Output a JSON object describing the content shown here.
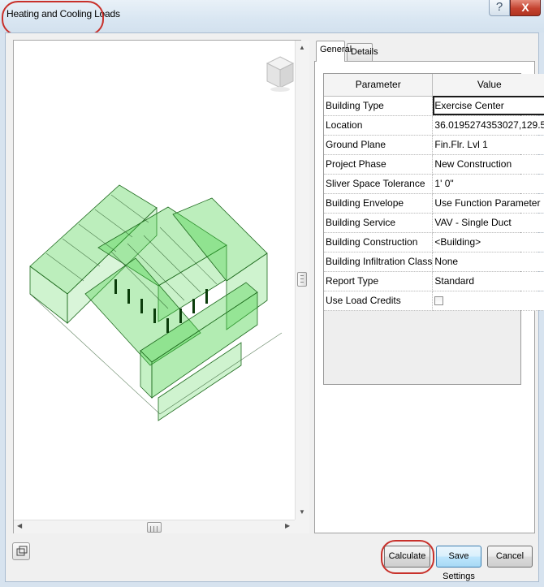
{
  "window": {
    "title": "Heating and Cooling Loads",
    "help_glyph": "?",
    "close_glyph": "X",
    "accent_annotation_color": "#c8302a"
  },
  "viewer": {
    "model_color": "#3fcf3f",
    "viewcube_icon": "viewcube-icon"
  },
  "tabs": [
    {
      "label": "General",
      "active": true
    },
    {
      "label": "Details",
      "active": false
    }
  ],
  "grid": {
    "headers": {
      "parameter": "Parameter",
      "value": "Value"
    },
    "rows": [
      {
        "parameter": "Building Type",
        "value": "Exercise Center"
      },
      {
        "parameter": "Location",
        "value": "36.0195274353027,129.5"
      },
      {
        "parameter": "Ground Plane",
        "value": "Fin.Flr. Lvl 1"
      },
      {
        "parameter": "Project Phase",
        "value": "New Construction"
      },
      {
        "parameter": "Sliver Space Tolerance",
        "value": "1'  0\""
      },
      {
        "parameter": "Building Envelope",
        "value": "Use Function Parameter"
      },
      {
        "parameter": "Building Service",
        "value": "VAV - Single Duct"
      },
      {
        "parameter": "Building Construction",
        "value": "<Building>"
      },
      {
        "parameter": "Building Infiltration Class",
        "value": "None"
      },
      {
        "parameter": "Report Type",
        "value": "Standard"
      },
      {
        "parameter": "Use Load Credits",
        "value": "",
        "checkbox": true,
        "checked": false
      }
    ]
  },
  "buttons": {
    "calculate": "Calculate",
    "save_settings": "Save Settings",
    "cancel": "Cancel"
  }
}
